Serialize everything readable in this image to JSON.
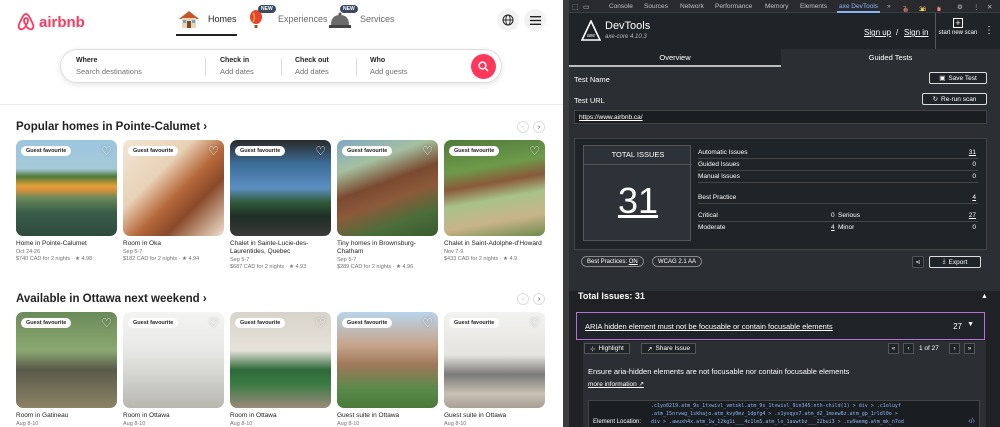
{
  "airbnb": {
    "logo_text": "airbnb",
    "nav": [
      {
        "label": "Homes",
        "badge": ""
      },
      {
        "label": "Experiences",
        "badge": "NEW"
      },
      {
        "label": "Services",
        "badge": "NEW"
      }
    ],
    "search": {
      "where_label": "Where",
      "where_placeholder": "Search destinations",
      "checkin_label": "Check in",
      "checkin_placeholder": "Add dates",
      "checkout_label": "Check out",
      "checkout_placeholder": "Add dates",
      "who_label": "Who",
      "who_placeholder": "Add guests"
    },
    "section1_title": "Popular homes in Pointe-Calumet ›",
    "section2_title": "Available in Ottawa next weekend ›",
    "guest_favourite": "Guest favourite",
    "section1_cards": [
      {
        "title": "Home in Pointe-Calumet",
        "dates": "Oct 24-26",
        "price": "$740 CAD for 2 nights · ★ 4.98"
      },
      {
        "title": "Room in Oka",
        "dates": "Sep 5-7",
        "price": "$182 CAD for 2 nights · ★ 4.94"
      },
      {
        "title": "Chalet in Sainte-Lucie-des-Laurentides, Quebec",
        "dates": "Sep 5-7",
        "price": "$687 CAD for 2 nights · ★ 4.93"
      },
      {
        "title": "Tiny homes in Brownsburg-Chatham",
        "dates": "Sep 5-7",
        "price": "$289 CAD for 2 nights · ★ 4.96"
      },
      {
        "title": "Chalet in Saint-Adolphe-d'Howard",
        "dates": "Nov 7-9",
        "price": "$433 CAD for 2 nights · ★ 4.9"
      }
    ],
    "section2_cards": [
      {
        "title": "Room in Gatineau",
        "dates": "Aug 8-10"
      },
      {
        "title": "Room in Ottawa",
        "dates": "Aug 8-10"
      },
      {
        "title": "Room in Ottawa",
        "dates": "Aug 8-10"
      },
      {
        "title": "Guest suite in Ottawa",
        "dates": "Aug 8-10"
      },
      {
        "title": "Guest suite in Ottawa",
        "dates": "Aug 8-10"
      }
    ]
  },
  "devtools": {
    "tabs": [
      "Console",
      "Sources",
      "Network",
      "Performance",
      "Memory",
      "Elements",
      "axe DevTools",
      "»"
    ],
    "counts": {
      "errors": "7",
      "warnings": "36",
      "info": "1"
    },
    "axe": {
      "name": "DevTools",
      "version": "axe-core 4.10.3",
      "sign_up": "Sign up",
      "sign_in": "Sign in",
      "sep": "/",
      "start_new_scan": "start new scan",
      "tab_overview": "Overview",
      "tab_guided": "Guided Tests",
      "test_name_label": "Test Name",
      "save_test": "Save Test",
      "test_url_label": "Test URL",
      "rerun_scan": "Re-run scan",
      "url": "https://www.airbnb.ca/",
      "total_issues_title": "TOTAL ISSUES",
      "total_issues": "31",
      "automatic_label": "Automatic Issues",
      "automatic": "31",
      "guided_label": "Guided Issues",
      "guided": "0",
      "manual_label": "Manual Issues",
      "manual": "0",
      "best_practice_label": "Best Practice",
      "best_practice": "4",
      "critical_label": "Critical",
      "critical": "0",
      "serious_label": "Serious",
      "serious": "27",
      "moderate_label": "Moderate",
      "moderate": "4",
      "minor_label": "Minor",
      "minor": "0",
      "best_practices_badge": "Best Practices:",
      "best_practices_state": "ON",
      "wcag_badge": "WCAG 2.1 AA",
      "export": "Export",
      "total_issues_heading": "Total Issues: 31",
      "issue_title": "ARIA hidden element must not be focusable or contain focusable elements",
      "issue_count": "27",
      "highlight": "Highlight",
      "share_issue": "Share Issue",
      "page_of": "1 of 27",
      "issue_desc": "Ensure aria-hidden elements are not focusable nor contain focusable elements",
      "more_info": "more information",
      "element_location_label": "Element Location:",
      "code_line1": ".c1yo0219.atm_9s_1txwivl_vmtskl.atm_9s_1txwivl_9in345:nth-child(1) > div > .c1oluyf",
      "code_line2": ".atm_15nrvwg_1skhajo.atm_kvy0mz_1dpfg4 > .s1yvqyx7.atm_d2_1mxew8z.atm_gp_1rldl0o >",
      "code_line3": "div > .awuxh4x.atm_1w_12kg1i___4c1lm5.atm_lo_1auwtbz___22bui3 > .cw9aemg.atm_mk_n7od"
    }
  }
}
